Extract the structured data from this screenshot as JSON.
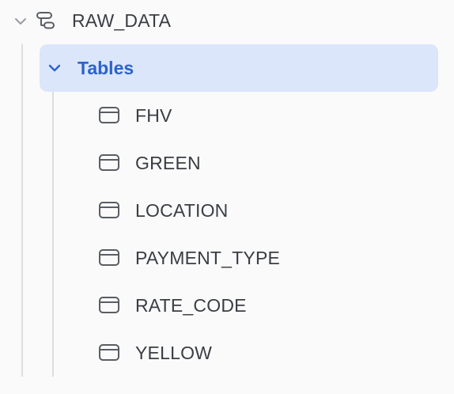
{
  "tree": {
    "schema": {
      "label": "RAW_DATA",
      "expanded": true,
      "icon": "schema-icon",
      "chevron": "chevron-down-icon"
    },
    "folder": {
      "label": "Tables",
      "expanded": true,
      "selected": true,
      "chevron": "chevron-down-icon"
    },
    "tables": [
      {
        "label": "FHV",
        "icon": "table-icon"
      },
      {
        "label": "GREEN",
        "icon": "table-icon"
      },
      {
        "label": "LOCATION",
        "icon": "table-icon"
      },
      {
        "label": "PAYMENT_TYPE",
        "icon": "table-icon"
      },
      {
        "label": "RATE_CODE",
        "icon": "table-icon"
      },
      {
        "label": "YELLOW",
        "icon": "table-icon"
      }
    ]
  },
  "colors": {
    "background": "#fafafa",
    "selected_background": "#dbe6fb",
    "selected_text": "#2d63c8",
    "text": "#3a3d44",
    "guide_line": "#dcdde1",
    "icon": "#5a5d64"
  }
}
